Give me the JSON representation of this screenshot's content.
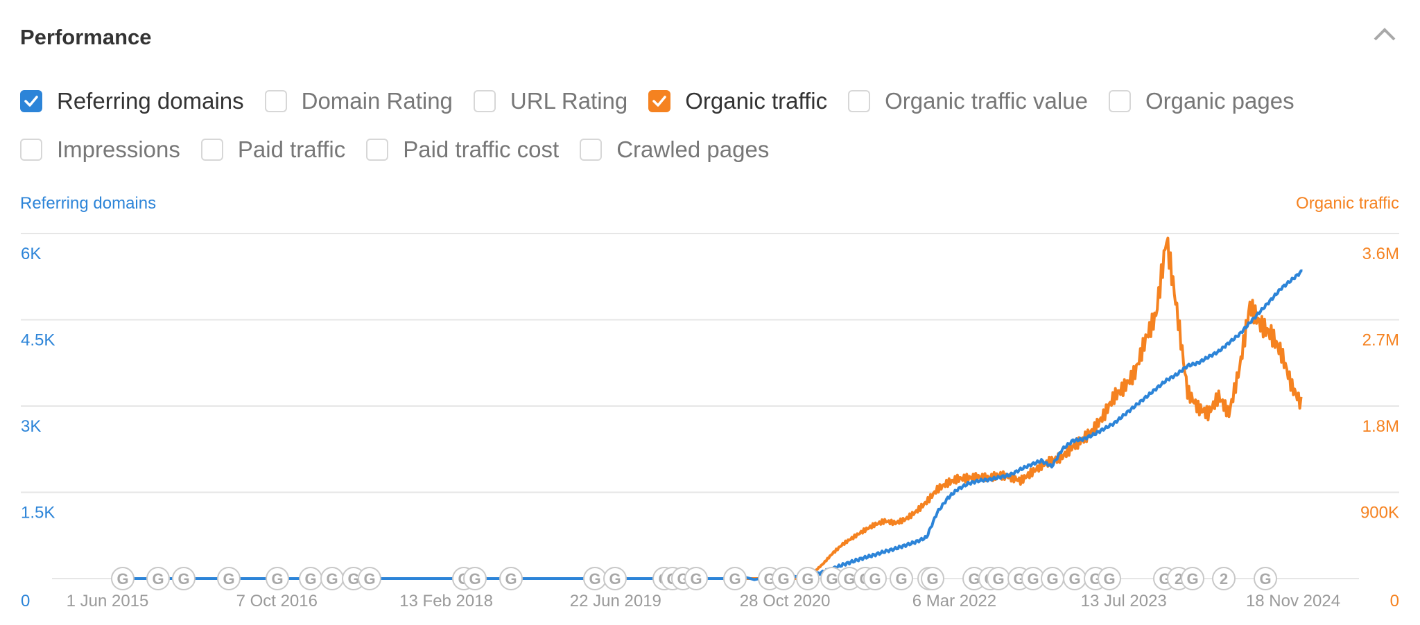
{
  "header": {
    "title": "Performance",
    "collapse_icon": "chevron-up-icon"
  },
  "metrics": [
    {
      "label": "Referring domains",
      "checked": true,
      "color": "#2c84d8"
    },
    {
      "label": "Domain Rating",
      "checked": false
    },
    {
      "label": "URL Rating",
      "checked": false
    },
    {
      "label": "Organic traffic",
      "checked": true,
      "color": "#f58220"
    },
    {
      "label": "Organic traffic value",
      "checked": false
    },
    {
      "label": "Organic pages",
      "checked": false
    },
    {
      "label": "Impressions",
      "checked": false
    },
    {
      "label": "Paid traffic",
      "checked": false
    },
    {
      "label": "Paid traffic cost",
      "checked": false
    },
    {
      "label": "Crawled pages",
      "checked": false
    }
  ],
  "chart_data": {
    "type": "line",
    "title": "",
    "ylabel_left": "Referring domains",
    "ylabel_right": "Organic traffic",
    "ylim_left": [
      0,
      6000
    ],
    "ylim_right": [
      0,
      3600000
    ],
    "yticks_left": [
      "0",
      "1.5K",
      "3K",
      "4.5K",
      "6K"
    ],
    "yticks_right": [
      "0",
      "900K",
      "1.8M",
      "2.7M",
      "3.6M"
    ],
    "xlim": [
      "2015-06-01",
      "2024-12-31"
    ],
    "xticks": [
      "1 Jun 2015",
      "7 Oct 2016",
      "13 Feb 2018",
      "22 Jun 2019",
      "28 Oct 2020",
      "6 Mar 2022",
      "13 Jul 2023",
      "18 Nov 2024"
    ],
    "grid": true,
    "legend": "checkbox-row-top",
    "x": [
      "2015-06",
      "2016-06",
      "2017-06",
      "2018-06",
      "2019-06",
      "2020-06",
      "2020-12",
      "2021-01",
      "2021-02",
      "2021-03",
      "2021-04",
      "2021-05",
      "2021-06",
      "2021-07",
      "2021-08",
      "2021-09",
      "2021-10",
      "2021-11",
      "2021-12",
      "2022-01",
      "2022-02",
      "2022-03",
      "2022-04",
      "2022-05",
      "2022-06",
      "2022-07",
      "2022-08",
      "2022-09",
      "2022-10",
      "2022-11",
      "2022-12",
      "2023-01",
      "2023-02",
      "2023-03",
      "2023-04",
      "2023-05",
      "2023-06",
      "2023-07",
      "2023-08",
      "2023-09",
      "2023-10",
      "2023-11",
      "2023-12",
      "2024-01",
      "2024-02",
      "2024-03",
      "2024-04",
      "2024-05",
      "2024-06",
      "2024-07",
      "2024-08",
      "2024-09",
      "2024-10",
      "2024-11",
      "2024-12"
    ],
    "series": [
      {
        "name": "Referring domains",
        "axis": "left",
        "color": "#2c84d8",
        "values": [
          0,
          0,
          0,
          0,
          0,
          0,
          20,
          60,
          110,
          170,
          240,
          300,
          360,
          410,
          470,
          520,
          580,
          640,
          720,
          1150,
          1400,
          1550,
          1650,
          1700,
          1720,
          1760,
          1800,
          1900,
          1980,
          2050,
          1950,
          2250,
          2400,
          2420,
          2500,
          2600,
          2700,
          2850,
          3000,
          3150,
          3300,
          3450,
          3550,
          3700,
          3750,
          3850,
          3950,
          4100,
          4250,
          4450,
          4650,
          4850,
          5050,
          5200,
          5350
        ]
      },
      {
        "name": "Organic traffic",
        "axis": "right",
        "color": "#f58220",
        "values": [
          0,
          0,
          0,
          0,
          0,
          0,
          0,
          50000,
          150000,
          260000,
          360000,
          430000,
          500000,
          560000,
          600000,
          580000,
          620000,
          700000,
          800000,
          930000,
          1000000,
          1040000,
          1050000,
          1060000,
          1050000,
          1080000,
          1060000,
          1020000,
          1100000,
          1180000,
          1230000,
          1270000,
          1380000,
          1450000,
          1550000,
          1700000,
          1900000,
          2000000,
          2150000,
          2500000,
          2750000,
          3550000,
          2800000,
          1950000,
          1780000,
          1720000,
          1900000,
          1720000,
          2200000,
          2850000,
          2650000,
          2550000,
          2350000,
          2000000,
          1800000,
          1850000
        ]
      }
    ],
    "annotations": {
      "google_update_markers": [
        "G",
        "G",
        "G",
        "G",
        "G",
        "G",
        "G",
        "G",
        "G",
        "G",
        "G",
        "G",
        "G",
        "G",
        "G",
        "G",
        "G",
        "G",
        "G",
        "G",
        "G",
        "G",
        "G",
        "G",
        "G",
        "G",
        "G",
        "G",
        "G",
        "G",
        "G",
        "G",
        "G",
        "G",
        "G",
        "G",
        "G",
        "G",
        "G",
        "2",
        "G",
        "2",
        "G"
      ]
    }
  }
}
